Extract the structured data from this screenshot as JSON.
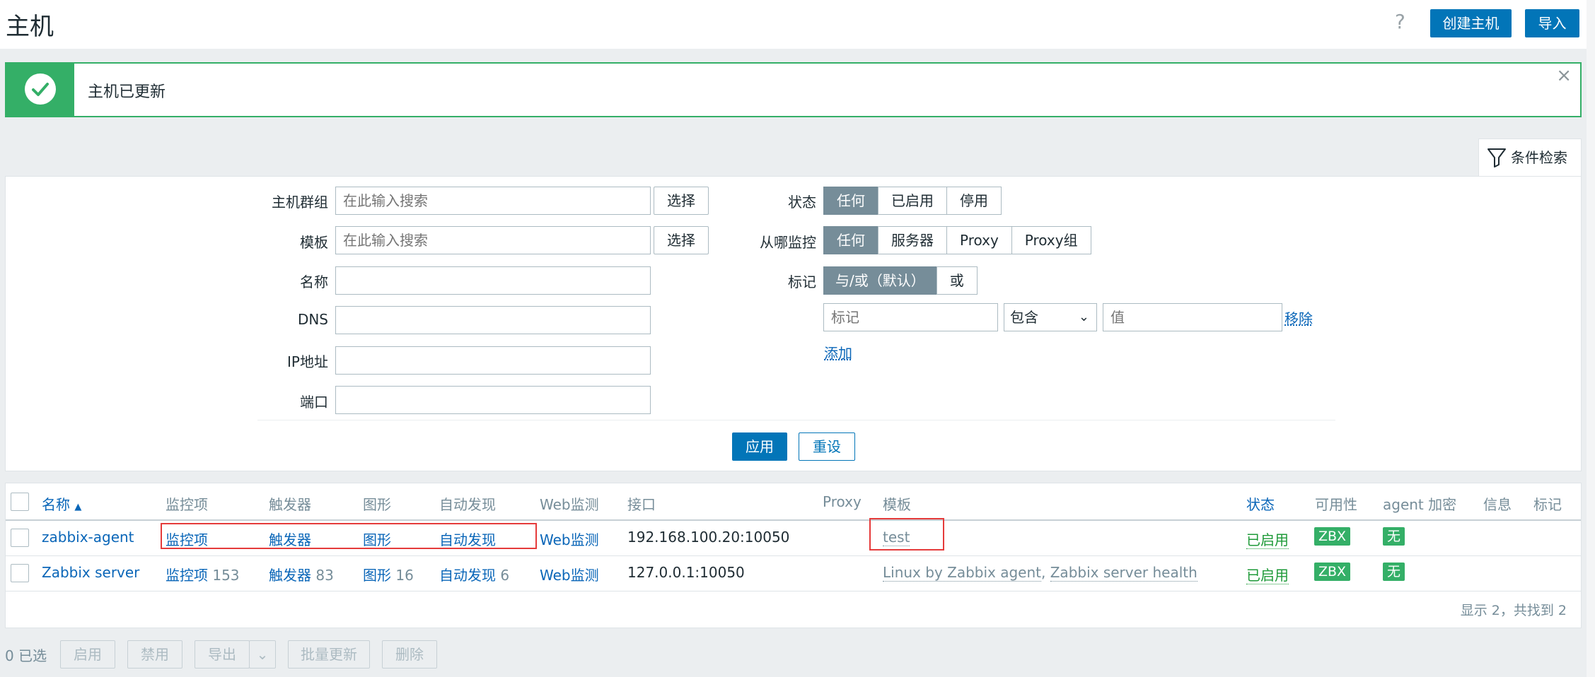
{
  "header": {
    "title": "主机",
    "help_icon": "question-mark-icon",
    "create_host": "创建主机",
    "import": "导入"
  },
  "message": {
    "text": "主机已更新",
    "icon": "check-circle-icon",
    "color": "#34af67"
  },
  "filter_tab": {
    "label": "条件检索",
    "icon": "funnel-icon"
  },
  "filter": {
    "host_groups": {
      "label": "主机群组",
      "placeholder": "在此输入搜索",
      "button": "选择"
    },
    "templates": {
      "label": "模板",
      "placeholder": "在此输入搜索",
      "button": "选择"
    },
    "name": {
      "label": "名称",
      "value": ""
    },
    "dns": {
      "label": "DNS",
      "value": ""
    },
    "ip": {
      "label": "IP地址",
      "value": ""
    },
    "port": {
      "label": "端口",
      "value": ""
    },
    "status": {
      "label": "状态",
      "options": [
        "任何",
        "已启用",
        "停用"
      ],
      "selected": "任何"
    },
    "monitored_by": {
      "label": "从哪监控",
      "options": [
        "任何",
        "服务器",
        "Proxy",
        "Proxy组"
      ],
      "selected": "任何"
    },
    "tags": {
      "label": "标记",
      "options": [
        "与/或（默认）",
        "或"
      ],
      "selected": "与/或（默认）",
      "tag_placeholder": "标记",
      "operator": "包含",
      "value_placeholder": "值",
      "remove": "移除",
      "add": "添加"
    },
    "apply": "应用",
    "reset": "重设"
  },
  "table": {
    "columns": {
      "name": "名称",
      "items": "监控项",
      "triggers": "触发器",
      "graphs": "图形",
      "discovery": "自动发现",
      "web": "Web监测",
      "interface": "接口",
      "proxy": "Proxy",
      "templates": "模板",
      "status": "状态",
      "availability": "可用性",
      "encryption": "agent 加密",
      "info": "信息",
      "tags": "标记"
    },
    "rows": [
      {
        "name": "zabbix-agent",
        "items": "监控项",
        "items_count": "",
        "triggers": "触发器",
        "triggers_count": "",
        "graphs": "图形",
        "graphs_count": "",
        "discovery": "自动发现",
        "discovery_count": "",
        "web": "Web监测",
        "interface": "192.168.100.20:10050",
        "templates": [
          "test"
        ],
        "status": "已启用",
        "availability": "ZBX",
        "encryption": "无"
      },
      {
        "name": "Zabbix server",
        "items": "监控项",
        "items_count": "153",
        "triggers": "触发器",
        "triggers_count": "83",
        "graphs": "图形",
        "graphs_count": "16",
        "discovery": "自动发现",
        "discovery_count": "6",
        "web": "Web监测",
        "interface": "127.0.0.1:10050",
        "templates": [
          "Linux by Zabbix agent",
          "Zabbix server health"
        ],
        "status": "已启用",
        "availability": "ZBX",
        "encryption": "无"
      }
    ],
    "footer": "显示 2，共找到 2"
  },
  "actions": {
    "selected": "0 已选",
    "enable": "启用",
    "disable": "禁用",
    "export": "导出",
    "mass_update": "批量更新",
    "delete": "删除"
  }
}
